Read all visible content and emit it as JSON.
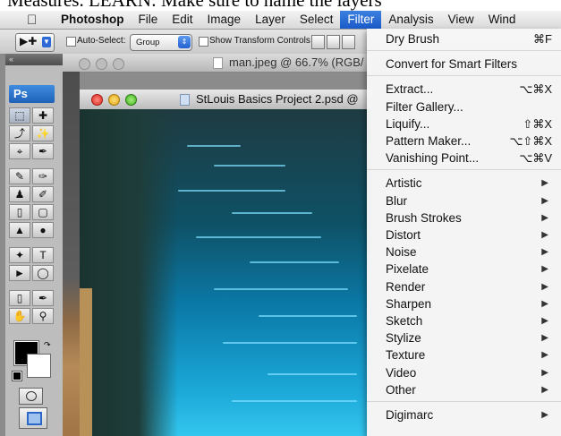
{
  "caption": "Measures. LEARN: Make sure to name the layers",
  "menubar": {
    "items": [
      {
        "label": "Photoshop",
        "bold": true
      },
      {
        "label": "File"
      },
      {
        "label": "Edit"
      },
      {
        "label": "Image"
      },
      {
        "label": "Layer"
      },
      {
        "label": "Select"
      },
      {
        "label": "Filter",
        "active": true
      },
      {
        "label": "Analysis"
      },
      {
        "label": "View"
      },
      {
        "label": "Wind"
      }
    ]
  },
  "options": {
    "auto_select_label": "Auto-Select:",
    "auto_select_value": "Group",
    "show_transform_label": "Show Transform Controls"
  },
  "app": {
    "ps_logo": "Ps"
  },
  "docs": {
    "back_title": "man.jpeg @ 66.7% (RGB/",
    "front_title": "StLouis Basics Project 2.psd @"
  },
  "filter_menu": {
    "groups": [
      [
        {
          "label": "Dry Brush",
          "shortcut": "⌘F"
        }
      ],
      [
        {
          "label": "Convert for Smart Filters"
        }
      ],
      [
        {
          "label": "Extract...",
          "shortcut": "⌥⌘X"
        },
        {
          "label": "Filter Gallery..."
        },
        {
          "label": "Liquify...",
          "shortcut": "⇧⌘X"
        },
        {
          "label": "Pattern Maker...",
          "shortcut": "⌥⇧⌘X"
        },
        {
          "label": "Vanishing Point...",
          "shortcut": "⌥⌘V"
        }
      ],
      [
        {
          "label": "Artistic",
          "submenu": true
        },
        {
          "label": "Blur",
          "submenu": true
        },
        {
          "label": "Brush Strokes",
          "submenu": true
        },
        {
          "label": "Distort",
          "submenu": true
        },
        {
          "label": "Noise",
          "submenu": true
        },
        {
          "label": "Pixelate",
          "submenu": true
        },
        {
          "label": "Render",
          "submenu": true
        },
        {
          "label": "Sharpen",
          "submenu": true
        },
        {
          "label": "Sketch",
          "submenu": true
        },
        {
          "label": "Stylize",
          "submenu": true
        },
        {
          "label": "Texture",
          "submenu": true
        },
        {
          "label": "Video",
          "submenu": true
        },
        {
          "label": "Other",
          "submenu": true
        }
      ],
      [
        {
          "label": "Digimarc",
          "submenu": true
        }
      ]
    ]
  },
  "colors": {
    "menu_highlight": "#2a6fd6",
    "foreground": "#000000",
    "background": "#ffffff"
  }
}
